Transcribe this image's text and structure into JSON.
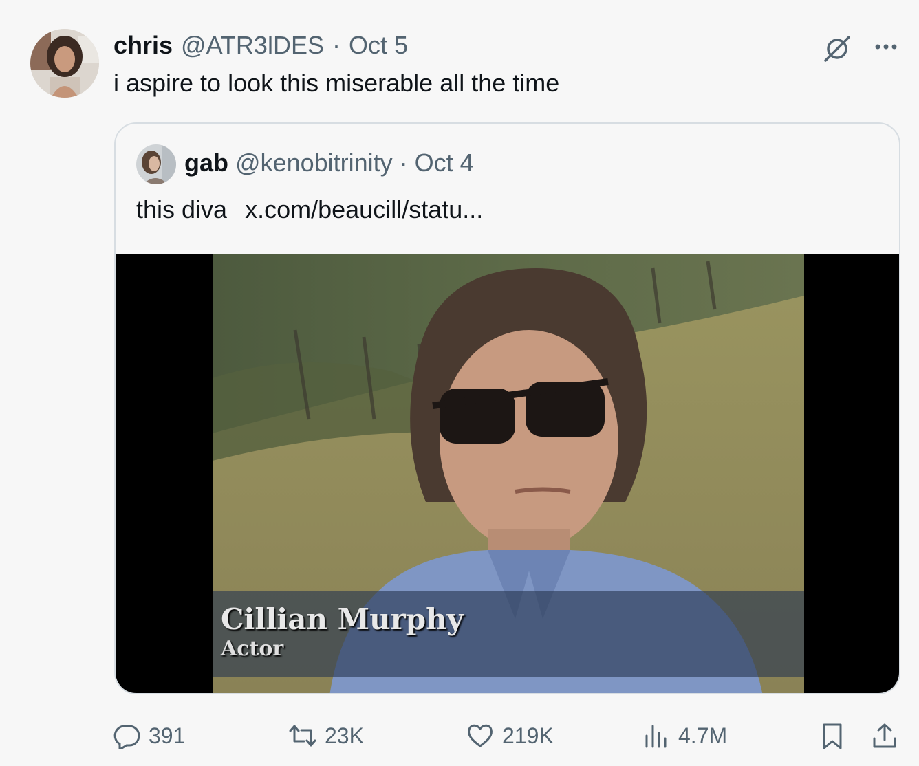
{
  "tweet": {
    "author_name": "chris",
    "author_handle": "@ATR3lDES",
    "separator": "·",
    "date": "Oct 5",
    "text": "i aspire to look this miserable all the time"
  },
  "quoted": {
    "author_name": "gab",
    "author_handle": "@kenobitrinity",
    "separator": "·",
    "date": "Oct 4",
    "text": "this diva",
    "link": "x.com/beaucill/statu...",
    "media": {
      "caption_name": "Cillian Murphy",
      "caption_role": "Actor"
    }
  },
  "actions": {
    "replies": "391",
    "reposts": "23K",
    "likes": "219K",
    "views": "4.7M"
  },
  "icons": {
    "grok": "grok-slash-circle-icon",
    "more": "more-dots-icon",
    "reply": "reply-bubble-icon",
    "repost": "repost-arrows-icon",
    "like": "heart-icon",
    "views": "bar-chart-icon",
    "bookmark": "bookmark-icon",
    "share": "share-upload-icon"
  },
  "colors": {
    "text": "#0f1419",
    "secondary": "#536471",
    "border": "#d7dde2",
    "background": "#f7f7f7"
  }
}
